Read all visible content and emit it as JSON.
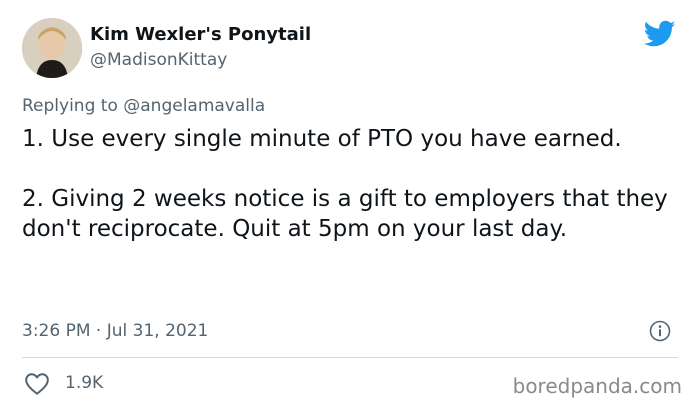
{
  "author": {
    "display_name": "Kim Wexler's Ponytail",
    "handle": "@MadisonKittay",
    "avatar_icon": "profile-photo"
  },
  "reply": {
    "prefix": "Replying to ",
    "target": "@angelamavalla"
  },
  "tweet": {
    "paragraph1": "1. Use every single minute of PTO you have earned.",
    "paragraph2": "2. Giving 2 weeks notice is a gift to employers that they don't reciprocate. Quit at 5pm on your last day."
  },
  "meta": {
    "timestamp": "3:26 PM · Jul 31, 2021",
    "info_icon": "info-icon"
  },
  "engagement": {
    "likes": "1.9K",
    "like_icon": "heart-icon"
  },
  "watermark": "boredpanda.com",
  "colors": {
    "twitter_blue": "#1d9bf0",
    "secondary_text": "#536471",
    "primary_text": "#0f1419"
  }
}
